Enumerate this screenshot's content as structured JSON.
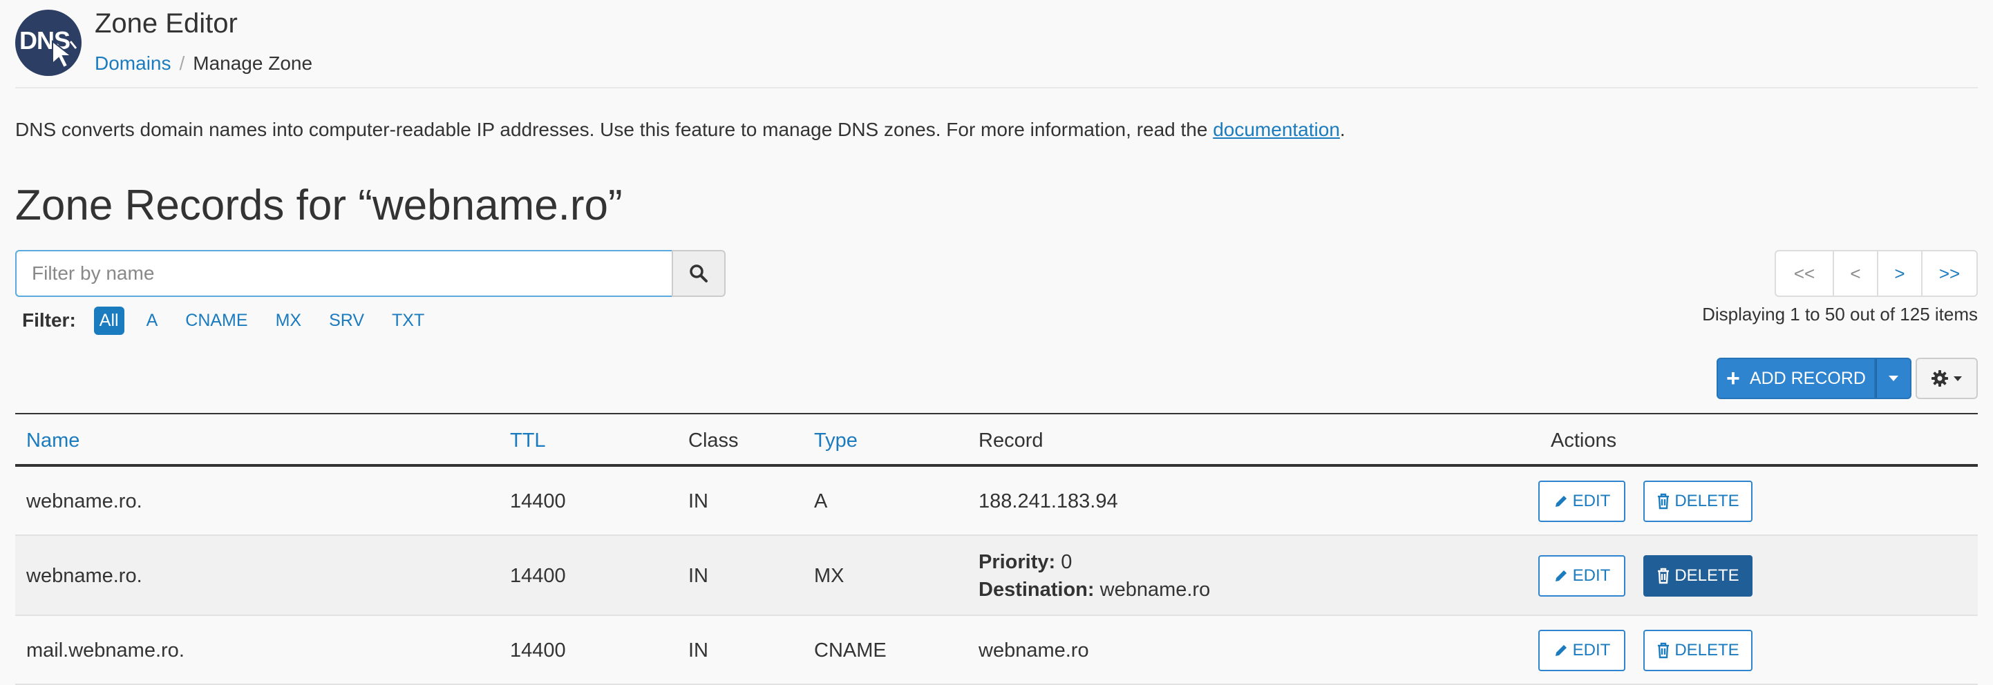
{
  "header": {
    "logo_text": "DNS",
    "app_title": "Zone Editor",
    "breadcrumb": {
      "parent": "Domains",
      "separator": "/",
      "current": "Manage Zone"
    }
  },
  "intro": {
    "text": "DNS converts domain names into computer-readable IP addresses. Use this feature to manage DNS zones. For more information, read the ",
    "link": "documentation",
    "suffix": "."
  },
  "zone_title": "Zone Records for “webname.ro”",
  "search": {
    "placeholder": "Filter by name",
    "value": ""
  },
  "filter": {
    "label": "Filter:",
    "options": [
      "All",
      "A",
      "CNAME",
      "MX",
      "SRV",
      "TXT"
    ],
    "active": "All"
  },
  "pagination": {
    "first": "<<",
    "prev": "<",
    "next": ">",
    "last": ">>",
    "displaying": "Displaying 1 to 50 out of 125 items"
  },
  "toolbar": {
    "add_record": "ADD RECORD",
    "plus": "+"
  },
  "table": {
    "headers": {
      "name": "Name",
      "ttl": "TTL",
      "class": "Class",
      "type": "Type",
      "record": "Record",
      "actions": "Actions"
    },
    "rows": [
      {
        "name": "webname.ro.",
        "ttl": "14400",
        "class": "IN",
        "type": "A",
        "record": "188.241.183.94"
      },
      {
        "name": "webname.ro.",
        "ttl": "14400",
        "class": "IN",
        "type": "MX",
        "priority_label": "Priority:",
        "priority": "0",
        "destination_label": "Destination:",
        "destination": "webname.ro"
      },
      {
        "name": "mail.webname.ro.",
        "ttl": "14400",
        "class": "IN",
        "type": "CNAME",
        "record": "webname.ro"
      }
    ],
    "edit_label": "EDIT",
    "delete_label": "DELETE"
  },
  "colors": {
    "accent": "#1b7bbf",
    "primary_button": "#2f84cf",
    "delete_hover": "#1f5e97"
  }
}
